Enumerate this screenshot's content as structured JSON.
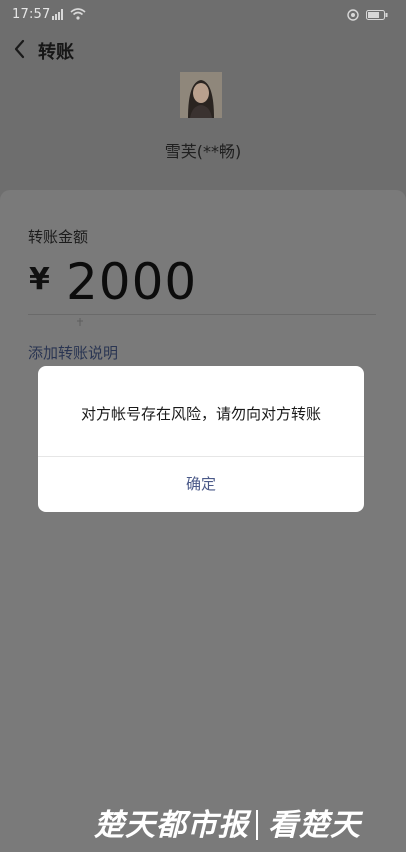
{
  "status_bar": {
    "time": "17:57",
    "icons": [
      "signal-icon",
      "wifi-icon",
      "alarm-icon",
      "battery-icon"
    ]
  },
  "nav": {
    "back_icon": "chevron-left-icon",
    "title": "转账"
  },
  "payee": {
    "name": "雪芙(**畅)"
  },
  "transfer": {
    "amount_label": "转账金额",
    "currency": "¥",
    "amount": "2000",
    "add_note": "添加转账说明"
  },
  "dialog": {
    "message": "对方帐号存在风险，请勿向对方转账",
    "confirm": "确定"
  },
  "watermark": {
    "text": "楚天都市报 | 看楚天"
  },
  "colors": {
    "overlay_background": "#6e6e6e",
    "dialog_background": "#ffffff",
    "confirm_text": "#4a5988",
    "link_text": "#2a3552"
  }
}
